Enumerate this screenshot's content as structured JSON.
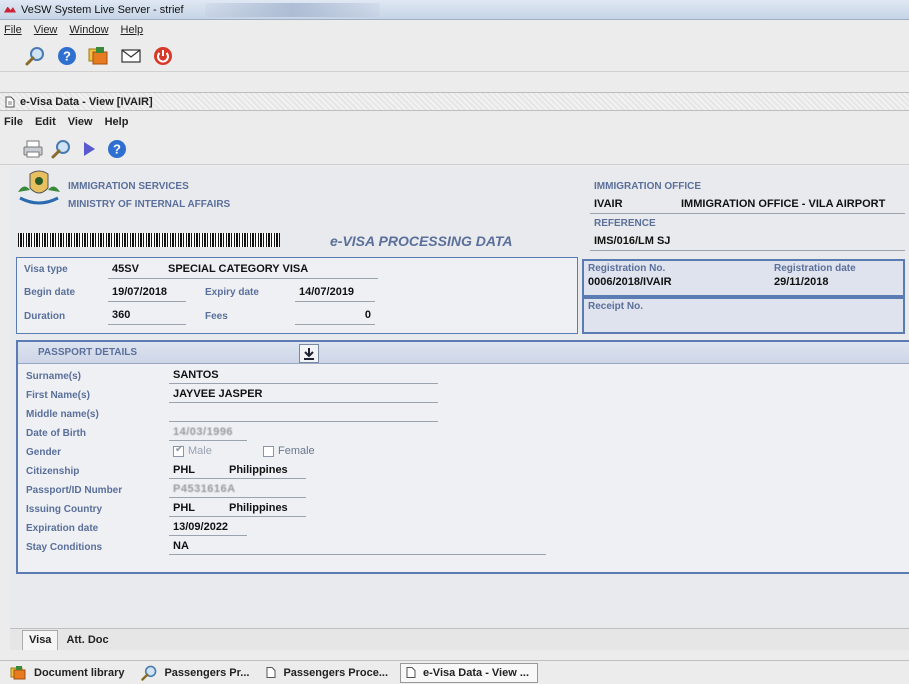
{
  "window": {
    "title": "VeSW System Live Server - strief"
  },
  "main_menu": {
    "file": "File",
    "view": "View",
    "window": "Window",
    "help": "Help"
  },
  "main_toolbar": {
    "icons": [
      "search-icon",
      "help-icon",
      "folders-icon",
      "mail-icon",
      "power-icon"
    ]
  },
  "subwindow": {
    "title": "e-Visa Data - View [IVAIR]",
    "menu": {
      "file": "File",
      "edit": "Edit",
      "view": "View",
      "help": "Help"
    },
    "toolbar_icons": [
      "print-icon",
      "search-icon",
      "play-icon",
      "help-icon"
    ]
  },
  "header": {
    "agency_line1": "IMMIGRATION SERVICES",
    "agency_line2": "MINISTRY OF INTERNAL AFFAIRS",
    "doc_title": "e-VISA PROCESSING DATA",
    "office_label": "IMMIGRATION OFFICE",
    "office_code": "IVAIR",
    "office_name": "IMMIGRATION OFFICE - VILA AIRPORT",
    "reference_label": "REFERENCE",
    "reference_value": "IMS/016/LM SJ"
  },
  "visa": {
    "type_label": "Visa type",
    "type_code": "45SV",
    "type_name": "SPECIAL CATEGORY VISA",
    "begin_label": "Begin date",
    "begin_value": "19/07/2018",
    "expiry_label": "Expiry date",
    "expiry_value": "14/07/2019",
    "duration_label": "Duration",
    "duration_value": "360",
    "fees_label": "Fees",
    "fees_value": "0"
  },
  "registration": {
    "no_label": "Registration No.",
    "no_value": "0006/2018/IVAIR",
    "date_label": "Registration date",
    "date_value": "29/11/2018",
    "receipt_label": "Receipt No.",
    "receipt_value": ""
  },
  "passport": {
    "section_title": "PASSPORT DETAILS",
    "surname_label": "Surname(s)",
    "surname_value": "SANTOS",
    "firstname_label": "First Name(s)",
    "firstname_value": "JAYVEE JASPER",
    "middlename_label": "Middle name(s)",
    "middlename_value": "",
    "dob_label": "Date of Birth",
    "dob_value": "14/03/1996",
    "gender_label": "Gender",
    "gender_male": "Male",
    "gender_female": "Female",
    "gender_selected": "Male",
    "citizenship_label": "Citizenship",
    "citizenship_code": "PHL",
    "citizenship_name": "Philippines",
    "passport_label": "Passport/ID Number",
    "passport_value": "P4531616A",
    "issuing_label": "Issuing Country",
    "issuing_code": "PHL",
    "issuing_name": "Philippines",
    "expiration_label": "Expiration date",
    "expiration_value": "13/09/2022",
    "stay_label": "Stay Conditions",
    "stay_value": "NA"
  },
  "tabs": {
    "visa": "Visa",
    "attdoc": "Att. Doc"
  },
  "taskbar": {
    "items": [
      "Document library",
      "Passengers Pr...",
      "Passengers Proce...",
      "e-Visa Data - View ..."
    ]
  },
  "colors": {
    "accent": "#5a6f9a",
    "panel_border": "#5b7bb3"
  }
}
